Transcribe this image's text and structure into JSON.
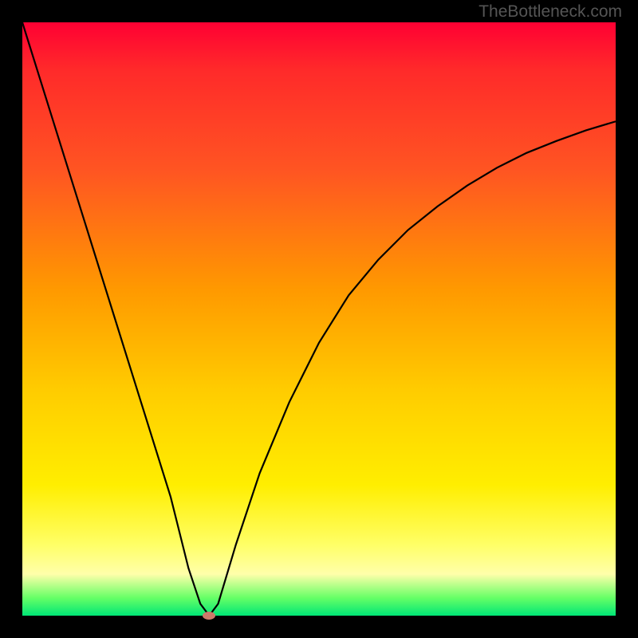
{
  "watermark": "TheBottleneck.com",
  "chart_data": {
    "type": "line",
    "title": "",
    "xlabel": "",
    "ylabel": "",
    "xlim": [
      0,
      100
    ],
    "ylim": [
      0,
      100
    ],
    "grid": false,
    "series": [
      {
        "name": "curve",
        "x": [
          0,
          5,
          10,
          15,
          20,
          25,
          28,
          30,
          31.5,
          33,
          36,
          40,
          45,
          50,
          55,
          60,
          65,
          70,
          75,
          80,
          85,
          90,
          95,
          100
        ],
        "y": [
          100,
          84,
          68,
          52,
          36,
          20,
          8,
          2,
          0,
          2,
          12,
          24,
          36,
          46,
          54,
          60,
          65,
          69,
          72.5,
          75.5,
          78,
          80,
          81.8,
          83.3
        ]
      }
    ],
    "marker": {
      "x": 31.5,
      "y": 0,
      "color": "#cc7a6a"
    },
    "background_gradient": {
      "top": "#ff0033",
      "bottom": "#00e676"
    }
  }
}
